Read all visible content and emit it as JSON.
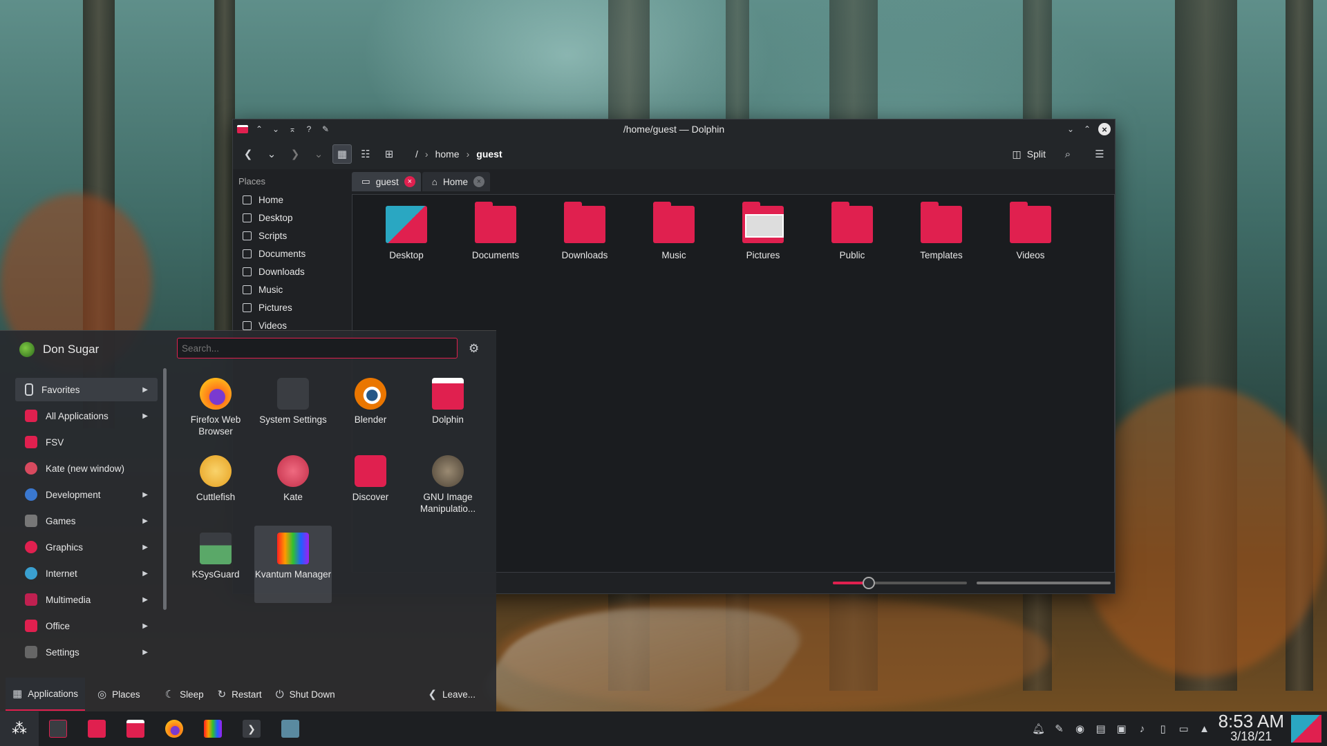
{
  "dolphin": {
    "title": "/home/guest — Dolphin",
    "breadcrumb": {
      "root": "/",
      "parts": [
        "home",
        "guest"
      ]
    },
    "split_label": "Split",
    "places_heading": "Places",
    "places": [
      "Home",
      "Desktop",
      "Scripts",
      "Documents",
      "Downloads",
      "Music",
      "Pictures",
      "Videos"
    ],
    "tabs": [
      "guest",
      "Home"
    ],
    "folders": [
      "Desktop",
      "Documents",
      "Downloads",
      "Music",
      "Pictures",
      "Public",
      "Templates",
      "Videos"
    ],
    "zoom_level": 0.27
  },
  "launcher": {
    "user": "Don Sugar",
    "search_placeholder": "Search...",
    "categories": [
      {
        "label": "Favorites",
        "color": "#2c2f34"
      },
      {
        "label": "All Applications",
        "color": "#e0204f"
      },
      {
        "label": "FSV",
        "color": "#e0204f"
      },
      {
        "label": "Kate (new window)",
        "color": "#d84a5f"
      },
      {
        "label": "Development",
        "color": "#3a78d0"
      },
      {
        "label": "Games",
        "color": "#777"
      },
      {
        "label": "Graphics",
        "color": "#e0204f"
      },
      {
        "label": "Internet",
        "color": "#3aa0d0"
      },
      {
        "label": "Multimedia",
        "color": "#c02050"
      },
      {
        "label": "Office",
        "color": "#e0204f"
      },
      {
        "label": "Settings",
        "color": "#666"
      }
    ],
    "apps": [
      {
        "name": "Firefox Web Browser",
        "color": "#ff7a1a"
      },
      {
        "name": "System Settings",
        "color": "#3a3d42"
      },
      {
        "name": "Blender",
        "color": "#ea7600"
      },
      {
        "name": "Dolphin",
        "color": "#e0204f"
      },
      {
        "name": "Cuttlefish",
        "color": "#f3b941"
      },
      {
        "name": "Kate",
        "color": "#d84a5f"
      },
      {
        "name": "Discover",
        "color": "#e0204f"
      },
      {
        "name": "GNU Image Manipulatio...",
        "color": "#7a6a52"
      },
      {
        "name": "KSysGuard",
        "color": "#5aa868"
      },
      {
        "name": "Kvantum Manager",
        "color": "#8a2be2"
      }
    ],
    "bottom": {
      "applications": "Applications",
      "places": "Places",
      "sleep": "Sleep",
      "restart": "Restart",
      "shutdown": "Shut Down",
      "leave": "Leave..."
    }
  },
  "taskbar": {
    "time": "8:53 AM",
    "date": "3/18/21"
  },
  "colors": {
    "accent": "#e0204f",
    "window_bg": "#1f2124"
  }
}
